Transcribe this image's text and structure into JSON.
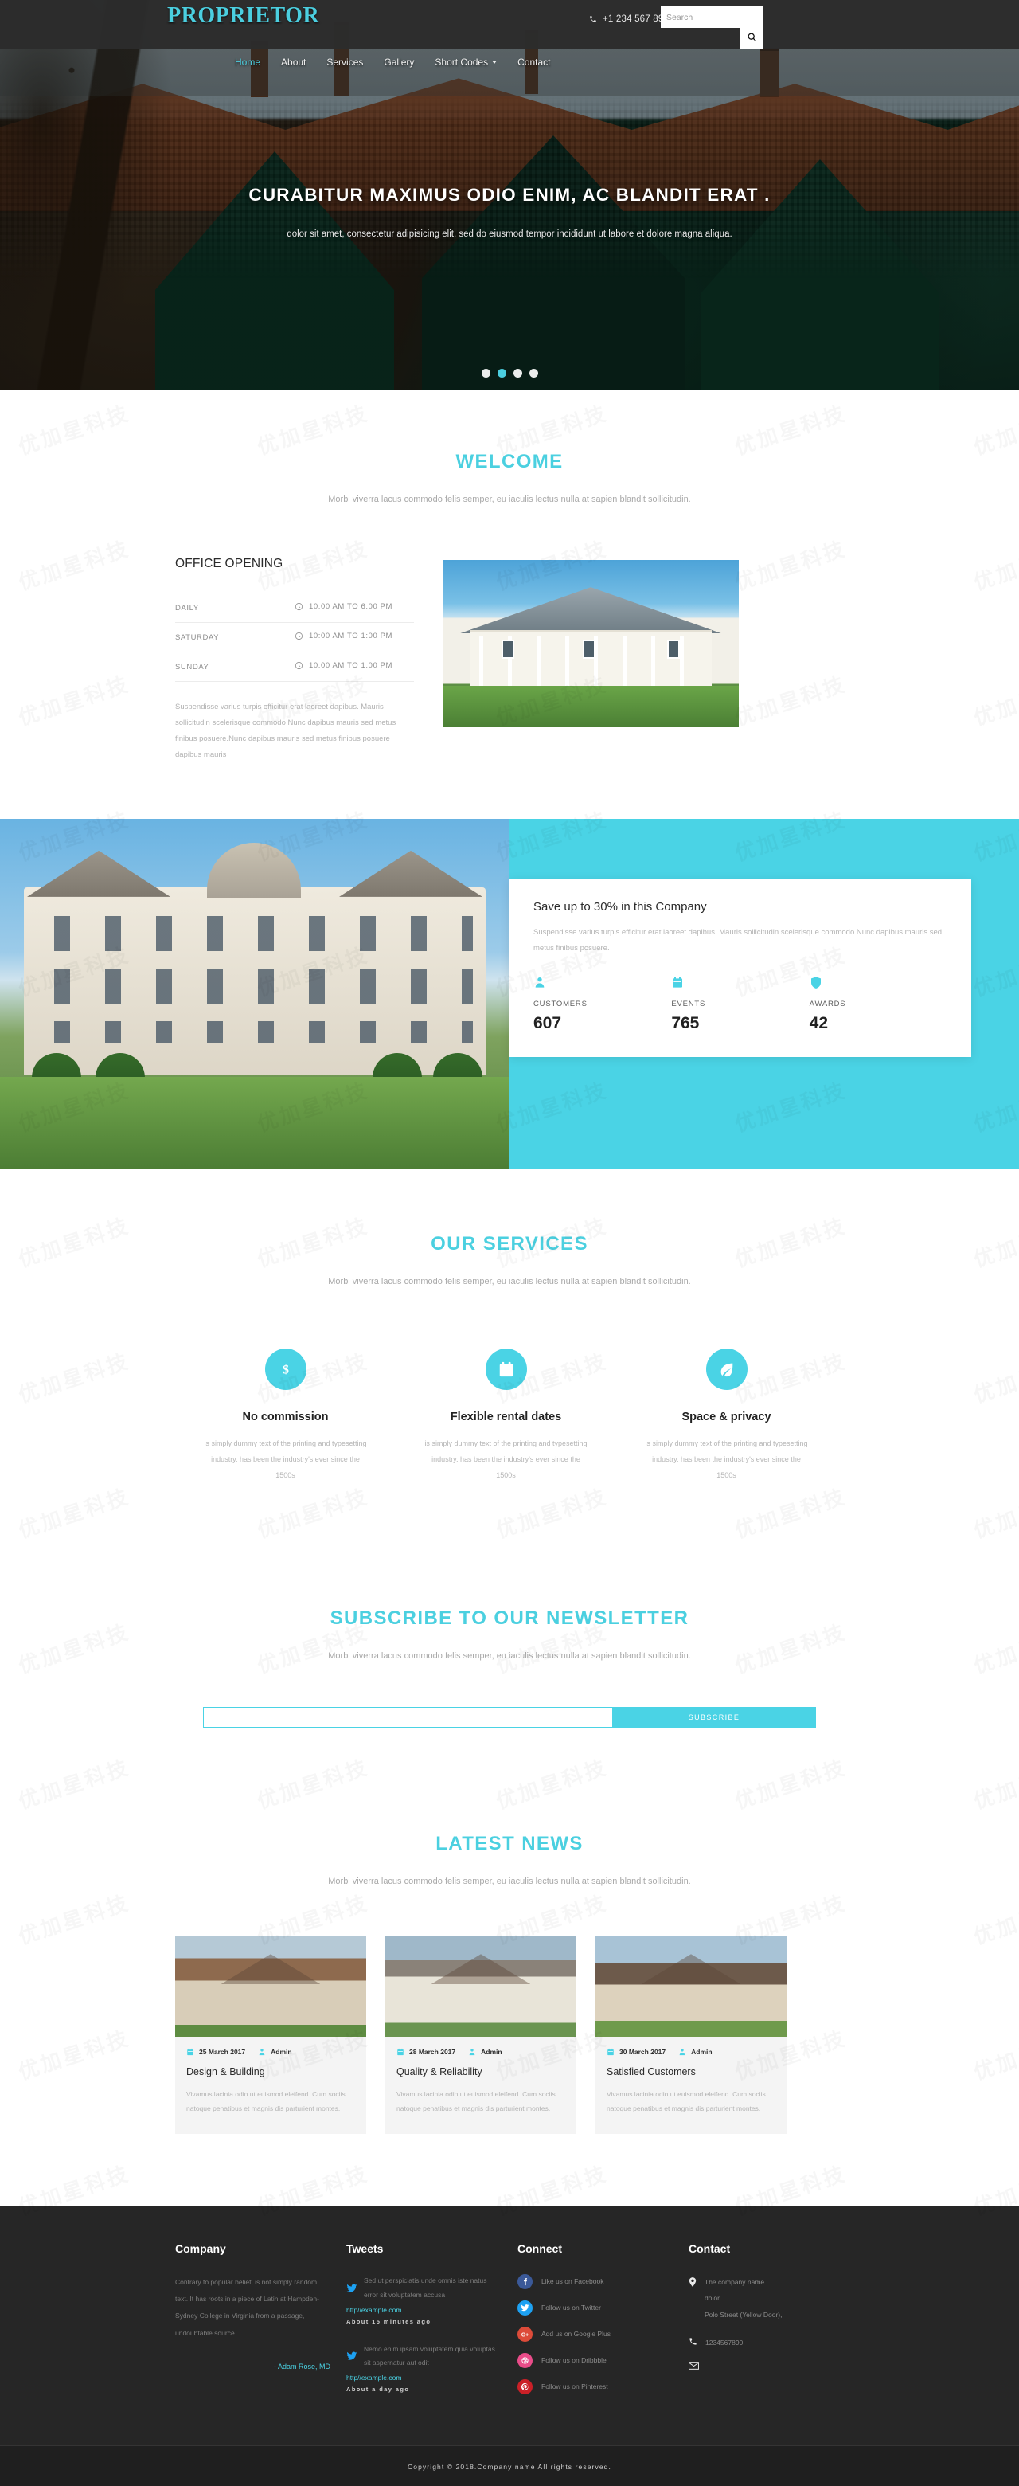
{
  "brand": {
    "name": "PROPRIETOR",
    "accent": "#4ad3e5",
    "dark": "#262626"
  },
  "header": {
    "phone": "+1 234 567 8901",
    "phone_icon": "phone-icon",
    "search_placeholder": "Search",
    "search_value": "",
    "search_icon": "search-icon"
  },
  "nav": {
    "items": [
      {
        "label": "Home",
        "active": true
      },
      {
        "label": "About",
        "active": false
      },
      {
        "label": "Services",
        "active": false
      },
      {
        "label": "Gallery",
        "active": false
      },
      {
        "label": "Short Codes",
        "active": false,
        "dropdown": true
      },
      {
        "label": "Contact",
        "active": false
      }
    ]
  },
  "hero": {
    "heading": "CURABITUR MAXIMUS ODIO ENIM, AC BLANDIT ERAT .",
    "subheading": "dolor sit amet, consectetur adipisicing elit, sed do eiusmod tempor incididunt ut labore et dolore magna aliqua.",
    "slides": 4,
    "active_slide": 2
  },
  "welcome": {
    "title": "WELCOME",
    "subtitle": "Morbi viverra lacus commodo felis semper, eu iaculis lectus nulla at sapien blandit sollicitudin.",
    "office": {
      "title": "OFFICE OPENING",
      "rows": [
        {
          "day": "DAILY",
          "hours": "10:00 AM TO 6:00 PM",
          "icon": "clock-icon"
        },
        {
          "day": "SATURDAY",
          "hours": "10:00 AM TO 1:00 PM",
          "icon": "clock-icon"
        },
        {
          "day": "SUNDAY",
          "hours": "10:00 AM TO 1:00 PM",
          "icon": "clock-icon"
        }
      ],
      "description": "Suspendisse varius turpis efficitur erat laoreet dapibus. Mauris sollicitudin scelerisque commodo Nunc dapibus mauris sed metus finibus posuere.Nunc dapibus mauris sed metus finibus posuere dapibus mauris"
    }
  },
  "promo": {
    "title": "Save up to 30% in this Company",
    "description": "Suspendisse varius turpis efficitur erat laoreet dapibus. Mauris sollicitudin scelerisque commodo.Nunc dapibus mauris sed metus finibus posuere.",
    "stats": [
      {
        "label": "CUSTOMERS",
        "value": "607",
        "icon": "user-icon"
      },
      {
        "label": "EVENTS",
        "value": "765",
        "icon": "calendar-icon"
      },
      {
        "label": "AWARDS",
        "value": "42",
        "icon": "shield-icon"
      }
    ]
  },
  "services": {
    "title": "OUR SERVICES",
    "subtitle": "Morbi viverra lacus commodo felis semper, eu iaculis lectus nulla at sapien blandit sollicitudin.",
    "items": [
      {
        "title": "No commission",
        "icon": "dollar-icon",
        "text": "is simply dummy text of the printing and typesetting industry. has been the industry's ever since the 1500s"
      },
      {
        "title": "Flexible rental dates",
        "icon": "calendar-icon",
        "text": "is simply dummy text of the printing and typesetting industry. has been the industry's ever since the 1500s"
      },
      {
        "title": "Space & privacy",
        "icon": "leaf-icon",
        "text": "is simply dummy text of the printing and typesetting industry. has been the industry's ever since the 1500s"
      }
    ]
  },
  "newsletter": {
    "title": "SUBSCRIBE TO OUR NEWSLETTER",
    "subtitle": "Morbi viverra lacus commodo felis semper, eu iaculis lectus nulla at sapien blandit sollicitudin.",
    "field1_value": "",
    "field2_value": "",
    "button": "SUBSCRIBE"
  },
  "latest_news": {
    "title": "LATEST NEWS",
    "subtitle": "Morbi viverra lacus commodo felis semper, eu iaculis lectus nulla at sapien blandit sollicitudin.",
    "cards": [
      {
        "date": "25 March 2017",
        "author": "Admin",
        "title": "Design & Building",
        "text": "Vivamus lacinia odio ut euismod eleifend. Cum sociis natoque penatibus et magnis dis parturient montes."
      },
      {
        "date": "28 March 2017",
        "author": "Admin",
        "title": "Quality & Reliability",
        "text": "Vivamus lacinia odio ut euismod eleifend. Cum sociis natoque penatibus et magnis dis parturient montes."
      },
      {
        "date": "30 March 2017",
        "author": "Admin",
        "title": "Satisfied Customers",
        "text": "Vivamus lacinia odio ut euismod eleifend. Cum sociis natoque penatibus et magnis dis parturient montes."
      }
    ]
  },
  "footer": {
    "company": {
      "title": "Company",
      "text": "Contrary to popular belief, is not simply random text. It has roots in a piece of Latin at Hampden-Sydney College in Virginia from a passage, undoubtable source",
      "signature": "- Adam Rose, MD"
    },
    "tweets": {
      "title": "Tweets",
      "items": [
        {
          "text": "Sed ut perspiciatis unde omnis iste natus error sit voluptatem accusa",
          "link": "http//example.com",
          "time": "About 15 minutes ago",
          "icon": "twitter-icon"
        },
        {
          "text": "Nemo enim ipsam voluptatem quia voluptas sit aspernatur aut odit",
          "link": "http//example.com",
          "time": "About a day ago",
          "icon": "twitter-icon"
        }
      ]
    },
    "connect": {
      "title": "Connect",
      "items": [
        {
          "label": "Like us on Facebook",
          "icon": "facebook-icon",
          "color": "#3b5998"
        },
        {
          "label": "Follow us on Twitter",
          "icon": "twitter-icon",
          "color": "#1da1f2"
        },
        {
          "label": "Add us on Google Plus",
          "icon": "google-plus-icon",
          "color": "#dd4b39"
        },
        {
          "label": "Follow us on Dribbble",
          "icon": "dribbble-icon",
          "color": "#ea4c89"
        },
        {
          "label": "Follow us on Pinterest",
          "icon": "pinterest-icon",
          "color": "#cb2027"
        }
      ]
    },
    "contact": {
      "title": "Contact",
      "address_line1": "The company name",
      "address_line2": "dolor,",
      "address_line3": "Polo Street (Yellow Door),",
      "phone": "1234567890",
      "location_icon": "location-pin-icon",
      "phone_icon": "phone-icon",
      "email_icon": "envelope-icon"
    },
    "copyright": "Copyright © 2018.Company name All rights reserved."
  }
}
